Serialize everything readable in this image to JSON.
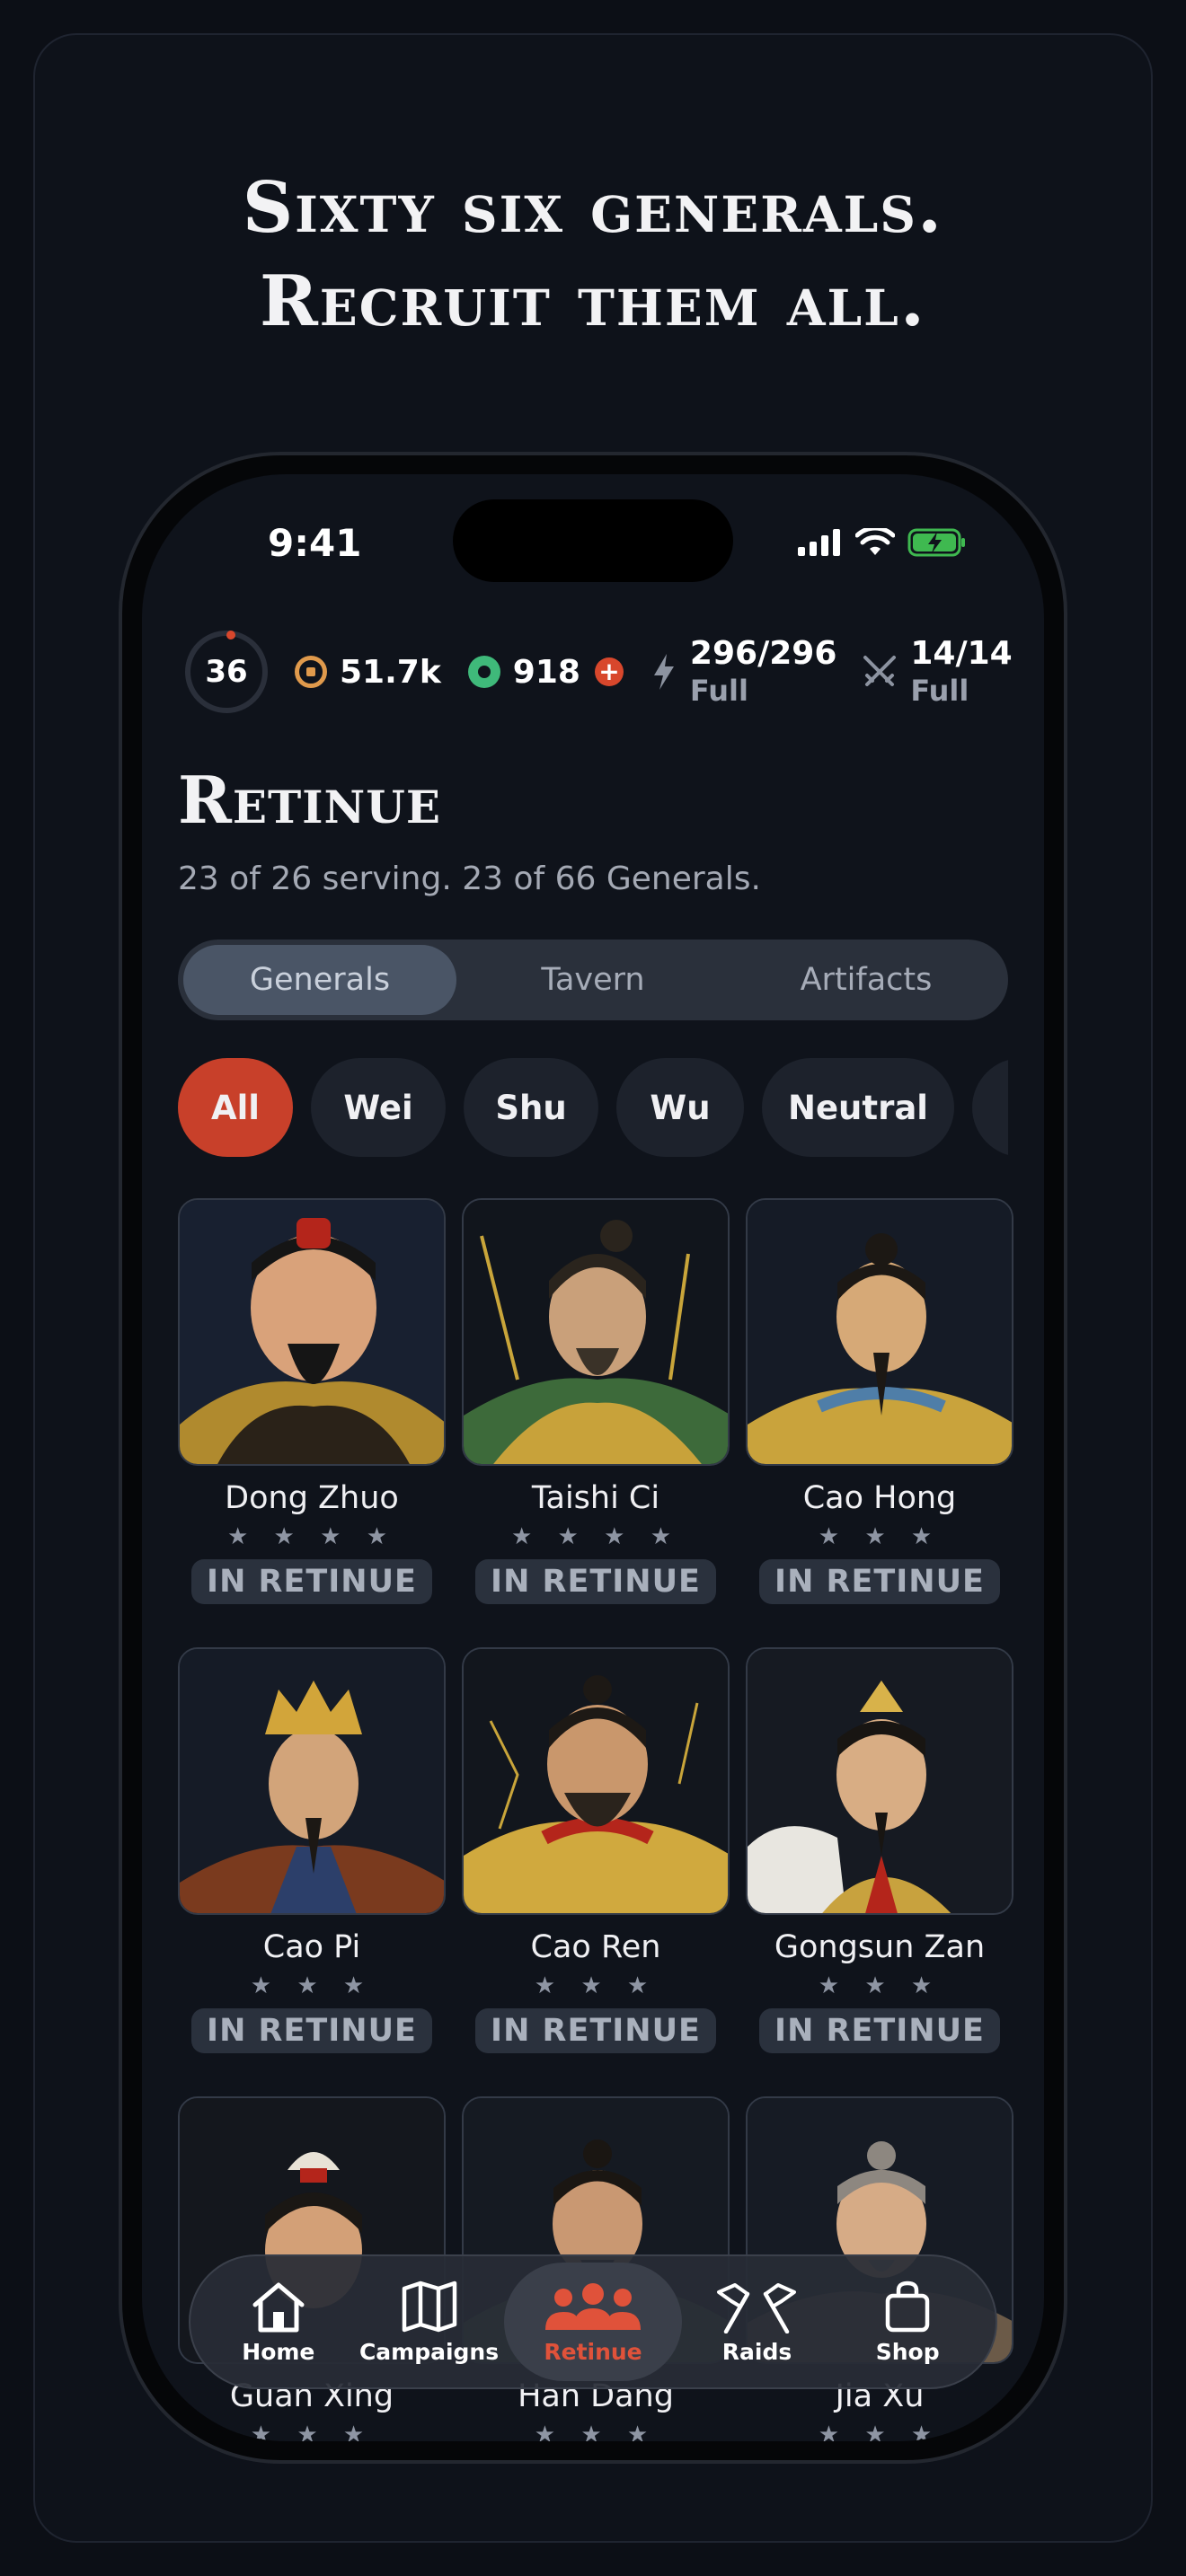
{
  "headline": {
    "line1": "Sixty six generals.",
    "line2": "Recruit them all."
  },
  "status_bar": {
    "time": "9:41"
  },
  "resources": {
    "level": "36",
    "coins": "51.7k",
    "gems": "918",
    "energy": {
      "value": "296/296",
      "state": "Full"
    },
    "battles": {
      "value": "14/14",
      "state": "Full"
    }
  },
  "page": {
    "title": "Retinue",
    "subtitle": "23 of 26 serving. 23 of 66 Generals."
  },
  "segments": [
    {
      "label": "Generals",
      "active": true
    },
    {
      "label": "Tavern",
      "active": false
    },
    {
      "label": "Artifacts",
      "active": false
    }
  ],
  "filters": [
    {
      "label": "All",
      "active": true
    },
    {
      "label": "Wei"
    },
    {
      "label": "Shu"
    },
    {
      "label": "Wu"
    },
    {
      "label": "Neutral"
    },
    {
      "label": ""
    }
  ],
  "generals": [
    {
      "name": "Dong Zhuo",
      "stars": "★ ★ ★ ★",
      "status": "IN RETINUE"
    },
    {
      "name": "Taishi Ci",
      "stars": "★ ★ ★ ★",
      "status": "IN RETINUE"
    },
    {
      "name": "Cao Hong",
      "stars": "★ ★ ★",
      "status": "IN RETINUE"
    },
    {
      "name": "Cao Pi",
      "stars": "★ ★ ★",
      "status": "IN RETINUE"
    },
    {
      "name": "Cao Ren",
      "stars": "★ ★ ★",
      "status": "IN RETINUE"
    },
    {
      "name": "Gongsun Zan",
      "stars": "★ ★ ★",
      "status": "IN RETINUE"
    },
    {
      "name": "Guan Xing",
      "stars": "★ ★ ★",
      "status": ""
    },
    {
      "name": "Han Dang",
      "stars": "★ ★ ★",
      "status": ""
    },
    {
      "name": "Jia Xu",
      "stars": "★ ★ ★",
      "status": ""
    }
  ],
  "tabbar": [
    {
      "label": "Home",
      "icon": "home-icon"
    },
    {
      "label": "Campaigns",
      "icon": "map-icon"
    },
    {
      "label": "Retinue",
      "icon": "people-icon",
      "active": true
    },
    {
      "label": "Raids",
      "icon": "flags-icon"
    },
    {
      "label": "Shop",
      "icon": "bag-icon"
    }
  ],
  "colors": {
    "accent": "#c8402a",
    "background": "#0f131b",
    "tab_active_label": "#e0523a"
  }
}
